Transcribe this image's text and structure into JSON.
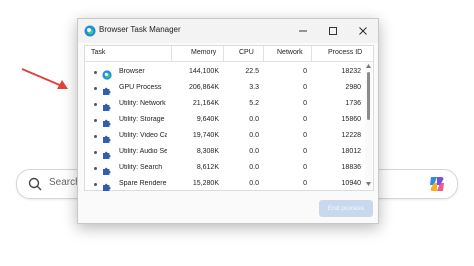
{
  "background": {
    "search_placeholder": "Search"
  },
  "window": {
    "title": "Browser Task Manager"
  },
  "table": {
    "columns": [
      "Task",
      "Memory",
      "CPU",
      "Network",
      "Process ID"
    ],
    "rows": [
      {
        "icon": "edge-browser-icon",
        "task": "Browser",
        "memory": "144,100K",
        "cpu": "22.5",
        "network": "0",
        "pid": "18232"
      },
      {
        "icon": "puzzle-icon",
        "task": "GPU Process",
        "memory": "206,864K",
        "cpu": "3.3",
        "network": "0",
        "pid": "2980"
      },
      {
        "icon": "puzzle-icon",
        "task": "Utility: Network",
        "memory": "21,164K",
        "cpu": "5.2",
        "network": "0",
        "pid": "1736"
      },
      {
        "icon": "puzzle-icon",
        "task": "Utility: Storage",
        "memory": "9,640K",
        "cpu": "0.0",
        "network": "0",
        "pid": "15860"
      },
      {
        "icon": "puzzle-icon",
        "task": "Utility: Video Capture",
        "memory": "19,740K",
        "cpu": "0.0",
        "network": "0",
        "pid": "12228"
      },
      {
        "icon": "puzzle-icon",
        "task": "Utility: Audio Service",
        "memory": "8,308K",
        "cpu": "0.0",
        "network": "0",
        "pid": "18012"
      },
      {
        "icon": "puzzle-icon",
        "task": "Utility: Search",
        "memory": "8,612K",
        "cpu": "0.0",
        "network": "0",
        "pid": "18836"
      },
      {
        "icon": "puzzle-icon",
        "task": "Spare Renderer",
        "memory": "15,280K",
        "cpu": "0.0",
        "network": "0",
        "pid": "10940"
      }
    ]
  },
  "footer": {
    "end_process_label": "End process"
  },
  "colors": {
    "accent_disabled": "#c8d9ee",
    "puzzle_blue": "#2f5fb3"
  }
}
